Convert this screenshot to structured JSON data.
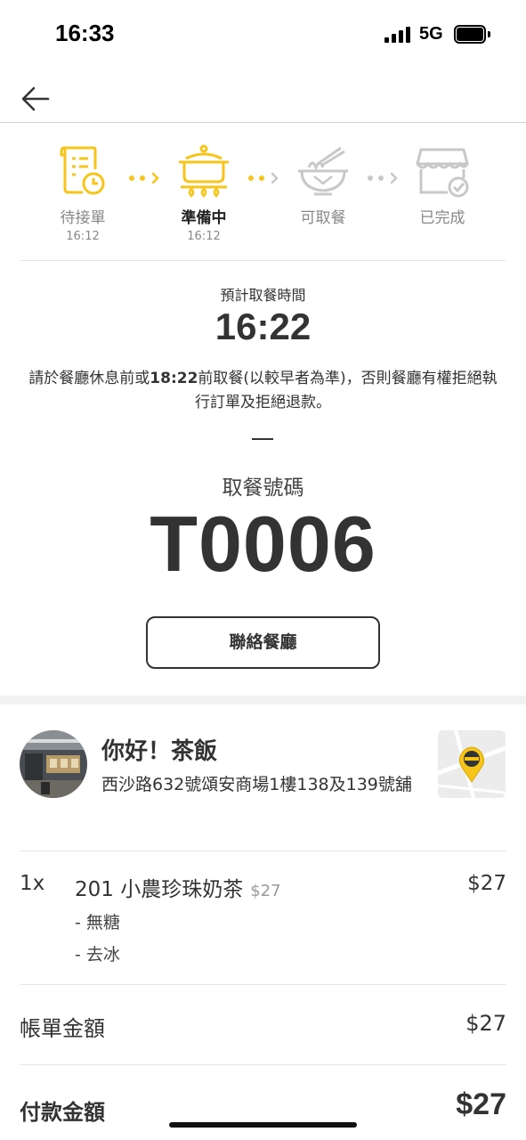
{
  "status_bar": {
    "time": "16:33",
    "network": "5G"
  },
  "colors": {
    "accent": "#f7c519",
    "inactive": "#c8c8c8",
    "text": "#333333"
  },
  "nav": {
    "back_icon": "arrow-left-icon"
  },
  "progress": {
    "steps": [
      {
        "label": "待接單",
        "time": "16:12",
        "state": "done",
        "icon": "receipt-clock-icon"
      },
      {
        "label": "準備中",
        "time": "16:12",
        "state": "active",
        "icon": "cooking-pot-icon"
      },
      {
        "label": "可取餐",
        "time": "",
        "state": "pending",
        "icon": "noodle-bowl-icon"
      },
      {
        "label": "已完成",
        "time": "",
        "state": "pending",
        "icon": "store-check-icon"
      }
    ]
  },
  "pickup": {
    "label": "預計取餐時間",
    "time": "16:22",
    "notice_before": "請於餐廳休息前或",
    "notice_bold": "18:22",
    "notice_after": "前取餐(以較早者為準)，否則餐廳有權拒絕執行訂單及拒絕退款。"
  },
  "pickup_number": {
    "label": "取餐號碼",
    "value": "T0006"
  },
  "contact_button": {
    "label": "聯絡餐廳"
  },
  "store": {
    "name": "你好！茶飯",
    "address": "西沙路632號頌安商場1樓138及139號舖",
    "map_icon": "map-pin-icon"
  },
  "order": {
    "items": [
      {
        "qty": "1x",
        "name": "201 小農珍珠奶茶",
        "unit_price": "$27",
        "price": "$27",
        "options": [
          "- 無糖",
          "- 去冰"
        ]
      }
    ]
  },
  "summary": {
    "bill_label": "帳單金額",
    "bill_value": "$27",
    "pay_label": "付款金額",
    "pay_value": "$27"
  }
}
